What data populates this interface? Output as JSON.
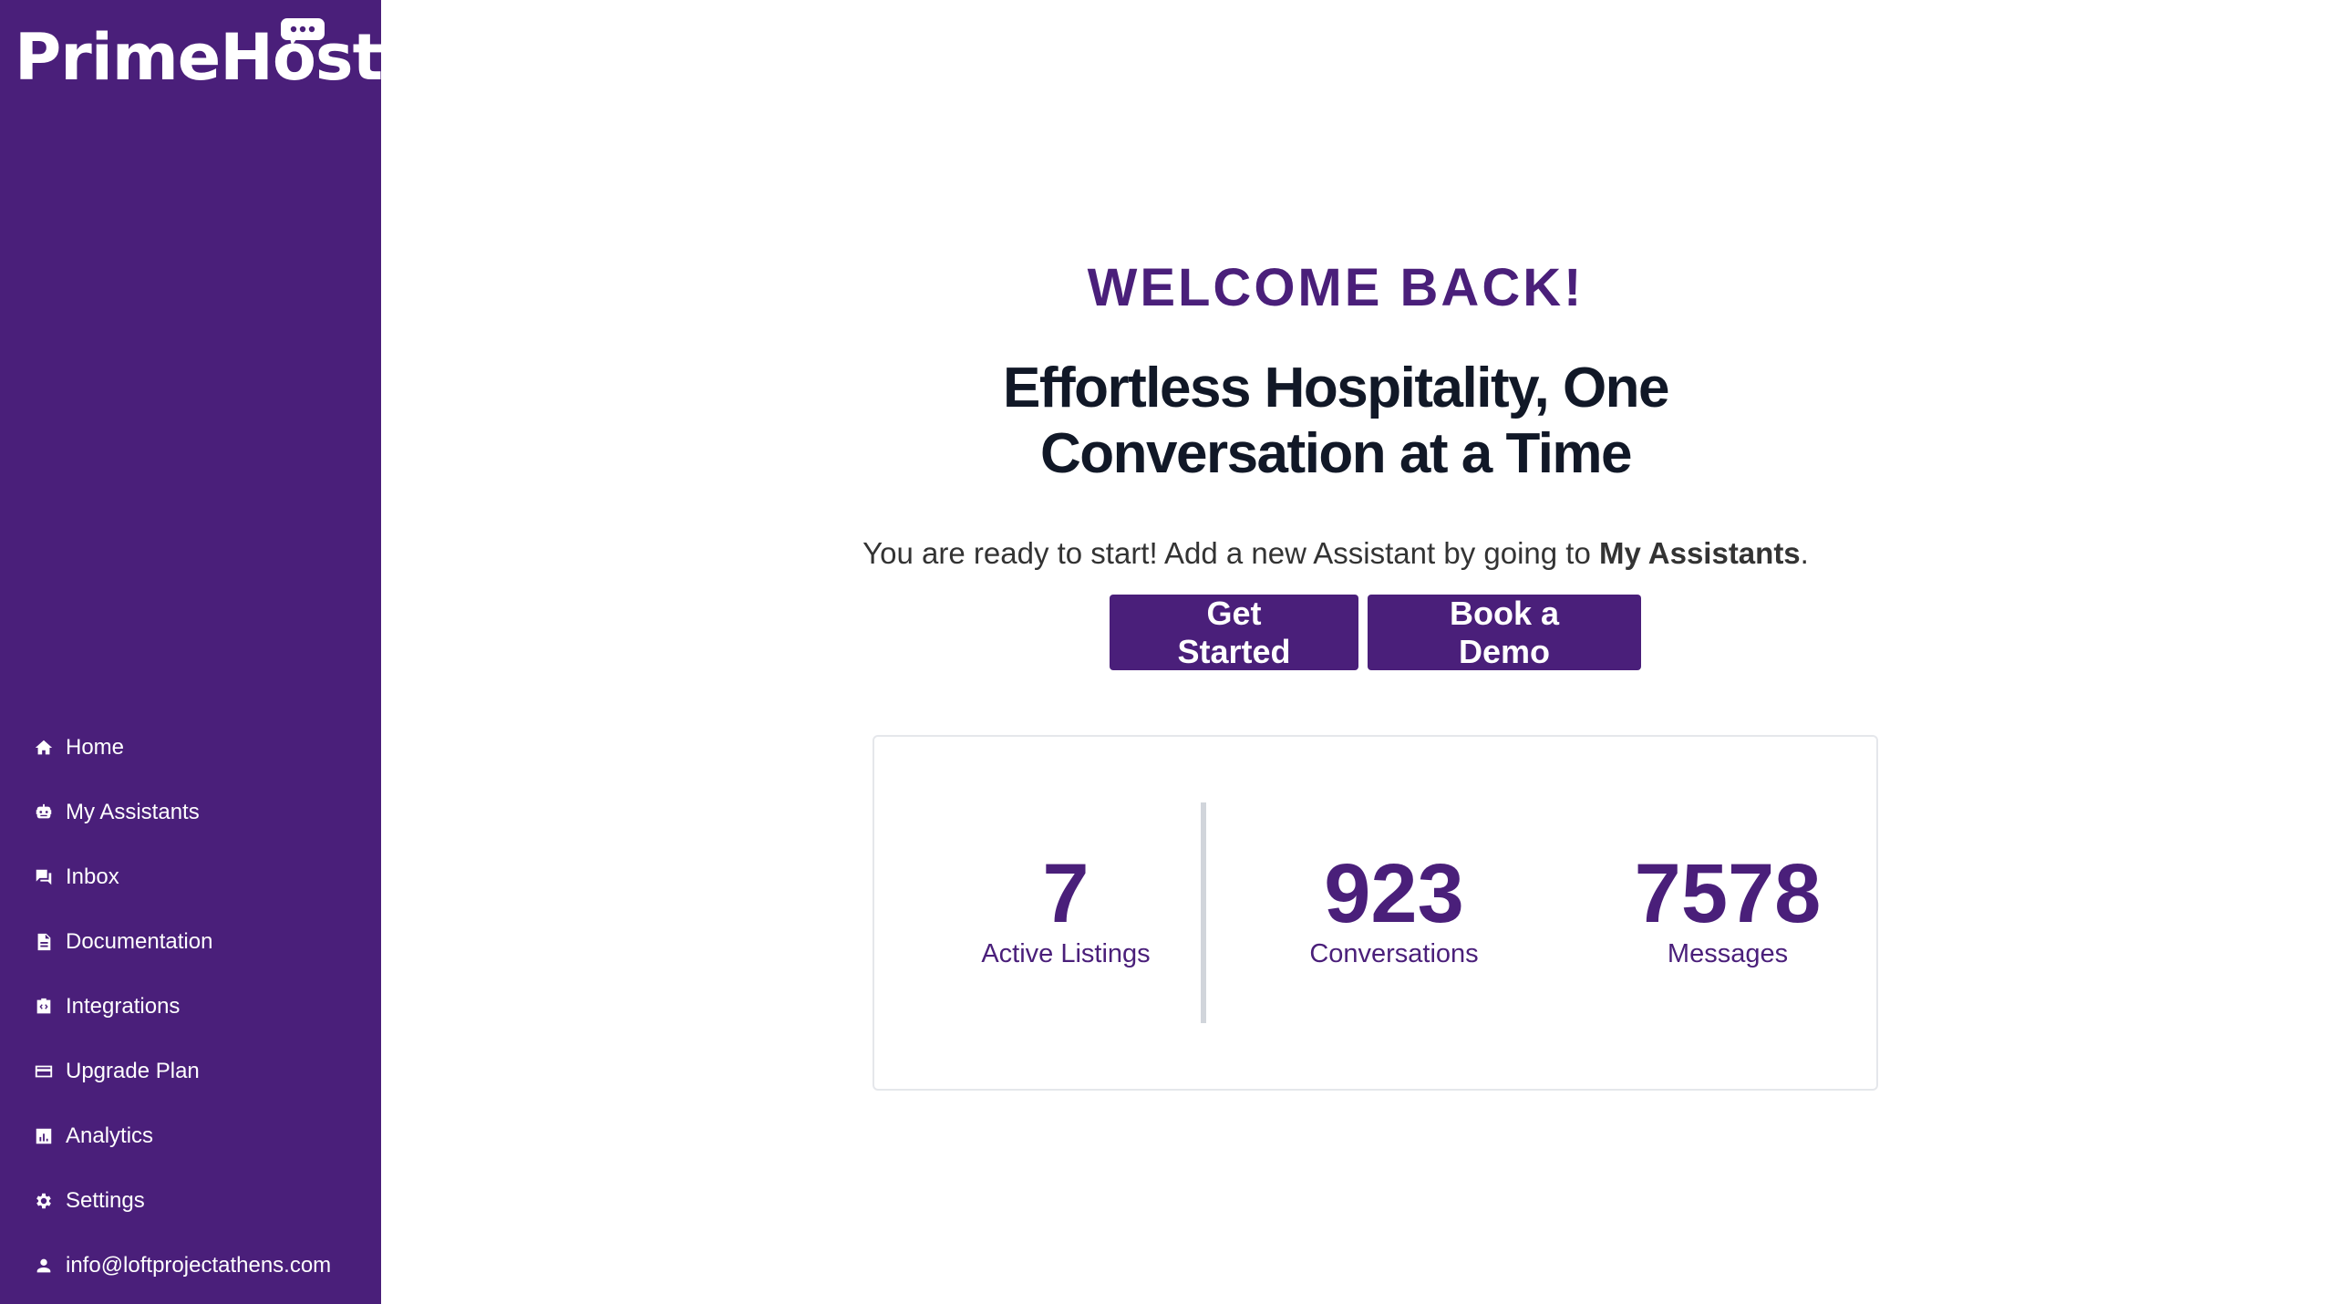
{
  "app": {
    "brand": "PrimeHost"
  },
  "sidebar": {
    "items": [
      {
        "label": "Home",
        "icon": "home-icon"
      },
      {
        "label": "My Assistants",
        "icon": "robot-icon"
      },
      {
        "label": "Inbox",
        "icon": "chat-icon"
      },
      {
        "label": "Documentation",
        "icon": "document-icon"
      },
      {
        "label": "Integrations",
        "icon": "integrations-icon"
      },
      {
        "label": "Upgrade Plan",
        "icon": "credit-card-icon"
      },
      {
        "label": "Analytics",
        "icon": "analytics-icon"
      },
      {
        "label": "Settings",
        "icon": "gear-icon"
      },
      {
        "label": "info@loftprojectathens.com",
        "icon": "user-icon"
      }
    ]
  },
  "main": {
    "welcome": "WELCOME BACK!",
    "headline_line1": "Effortless Hospitality, One",
    "headline_line2": "Conversation at a Time",
    "subtext_prefix": "You are ready to start! Add a new Assistant by going to ",
    "subtext_bold": "My Assistants",
    "subtext_suffix": ".",
    "get_started_label": "Get Started",
    "book_demo_label": "Book a Demo"
  },
  "stats": [
    {
      "value": "7",
      "label": "Active Listings"
    },
    {
      "value": "923",
      "label": "Conversations"
    },
    {
      "value": "7578",
      "label": "Messages"
    }
  ],
  "colors": {
    "brand_purple": "#4a1f7a",
    "headline": "#111827",
    "card_border": "#e5e7eb",
    "divider": "#d1d5db"
  }
}
